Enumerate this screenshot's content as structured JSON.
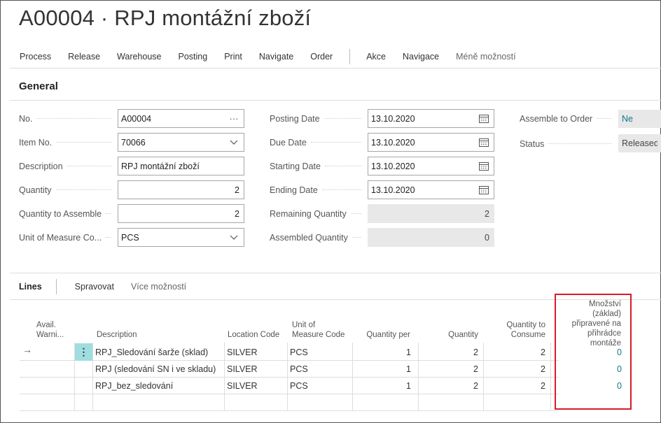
{
  "page": {
    "title": "A00004 · RPJ montážní zboží"
  },
  "actions": {
    "primary": [
      "Process",
      "Release",
      "Warehouse",
      "Posting",
      "Print",
      "Navigate",
      "Order"
    ],
    "secondary": [
      "Akce",
      "Navigace"
    ],
    "less_options": "Méně možností"
  },
  "general": {
    "section_title": "General",
    "no": {
      "label": "No.",
      "value": "A00004"
    },
    "item_no": {
      "label": "Item No.",
      "value": "70066"
    },
    "description": {
      "label": "Description",
      "value": "RPJ montážní zboží"
    },
    "quantity": {
      "label": "Quantity",
      "value": "2"
    },
    "quantity_to_assemble": {
      "label": "Quantity to Assemble",
      "value": "2"
    },
    "unit_of_measure_code": {
      "label": "Unit of Measure Co...",
      "value": "PCS"
    },
    "posting_date": {
      "label": "Posting Date",
      "value": "13.10.2020"
    },
    "due_date": {
      "label": "Due Date",
      "value": "13.10.2020"
    },
    "starting_date": {
      "label": "Starting Date",
      "value": "13.10.2020"
    },
    "ending_date": {
      "label": "Ending Date",
      "value": "13.10.2020"
    },
    "remaining_quantity": {
      "label": "Remaining Quantity",
      "value": "2"
    },
    "assembled_quantity": {
      "label": "Assembled Quantity",
      "value": "0"
    },
    "assemble_to_order": {
      "label": "Assemble to Order",
      "value": "Ne"
    },
    "status": {
      "label": "Status",
      "value": "Released"
    }
  },
  "lines": {
    "title": "Lines",
    "actions": [
      "Spravovat"
    ],
    "more_options": "Více možností",
    "columns": {
      "avail_warning": "Avail. Warni...",
      "description": "Description",
      "location_code": "Location Code",
      "unit_of_measure_code": "Unit of Measure Code",
      "quantity_per": "Quantity per",
      "quantity": "Quantity",
      "quantity_to_consume": "Quantity to Consume",
      "qty_picked_base": "Množství (základ) připravené na přihrádce montáže"
    },
    "rows": [
      {
        "description": "RPJ_Sledování šarže (sklad)",
        "location_code": "SILVER",
        "unit": "PCS",
        "quantity_per": "1",
        "quantity": "2",
        "quantity_to_consume": "2",
        "qty_picked_base": "0"
      },
      {
        "description": "RPJ (sledování SN i ve skladu)",
        "location_code": "SILVER",
        "unit": "PCS",
        "quantity_per": "1",
        "quantity": "2",
        "quantity_to_consume": "2",
        "qty_picked_base": "0"
      },
      {
        "description": "RPJ_bez_sledování",
        "location_code": "SILVER",
        "unit": "PCS",
        "quantity_per": "1",
        "quantity": "2",
        "quantity_to_consume": "2",
        "qty_picked_base": "0"
      }
    ]
  },
  "colors": {
    "highlight": "#d81b2a",
    "link": "#0e7a8a",
    "selected_cell": "#9fdde0"
  }
}
